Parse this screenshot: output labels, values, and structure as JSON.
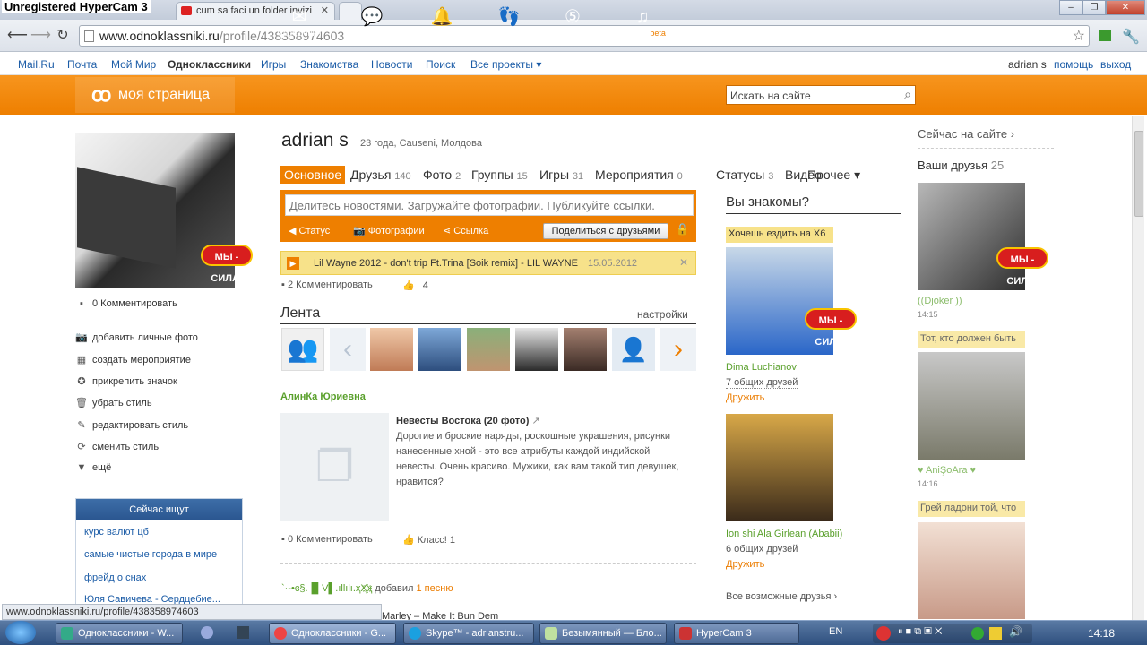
{
  "recorder_watermark": "Unregistered HyperCam 3",
  "browser": {
    "tabs": [
      {
        "title": "cum sa faci un folder invizi"
      }
    ],
    "url_host": "www.odnoklassniki.ru",
    "url_path": "/profile/438358974603"
  },
  "site_nav": {
    "left": [
      "Mail.Ru",
      "Почта",
      "Мой Мир",
      "Одноклассники",
      "Игры",
      "Знакомства",
      "Новости",
      "Поиск",
      "Все проекты ▾"
    ],
    "user": "adrian s",
    "help": "помощь",
    "logout": "выход"
  },
  "orange_bar": {
    "my_page": "моя страница",
    "items": [
      "Сообщения",
      "Обсуждения",
      "Оповещения",
      "Гости",
      "Оценки",
      "Музыка"
    ],
    "music_badge": "beta",
    "search_placeholder": "Искать на сайте"
  },
  "left_sidebar": {
    "avatar_badge": "МЫ - СИЛА!",
    "comment_count": "0 Комментировать",
    "actions": [
      "добавить личные фото",
      "создать мероприятие",
      "прикрепить значок",
      "убрать стиль",
      "редактировать стиль",
      "сменить стиль",
      "ещё"
    ],
    "now_searching_title": "Сейчас ищут",
    "now_searching": [
      "курс валют цб",
      "самые чистые города в мире",
      "фрейд о снах",
      "Юля Савичева - Сердцебие..."
    ]
  },
  "profile": {
    "name": "adrian s",
    "info": "23 года, Causeni, Молдова",
    "tabs": [
      {
        "label": "Основное",
        "count": ""
      },
      {
        "label": "Друзья",
        "count": "140"
      },
      {
        "label": "Фото",
        "count": "2"
      },
      {
        "label": "Группы",
        "count": "15"
      },
      {
        "label": "Игры",
        "count": "31"
      },
      {
        "label": "Мероприятия",
        "count": "0"
      },
      {
        "label": "Статусы",
        "count": "3"
      },
      {
        "label": "Видео",
        "count": ""
      },
      {
        "label": "Прочее ▾",
        "count": ""
      }
    ],
    "share_placeholder": "Делитесь новостями. Загружайте фотографии. Публикуйте ссылки.",
    "share_actions": [
      "Статус",
      "Фотографии",
      "Ссылка"
    ],
    "share_button": "Поделиться с друзьями",
    "now_playing": "Lil Wayne 2012 - don't trip Ft.Trina [Soik remix] - LIL WAYNE",
    "now_playing_date": "15.05.2012",
    "status_comment": "2 Комментировать",
    "status_likes": "4"
  },
  "feed": {
    "title": "Лента",
    "settings": "настройки",
    "author": "АлинКа Юриевна",
    "post_title": "Невесты Востока (20 фото)",
    "post_text": "Дорогие и броские наряды, роскошные украшения, рисунки нанесенные хной - это все атрибуты каждой индийской невесты. Очень красиво. Мужики, как вам такой тип девушек, нравится?",
    "post_comments": "0 Комментировать",
    "post_likes": "Класс! 1",
    "next_author": "`·-•ɞ§.▐▌V▌.ıllılı.ҳҲ҈ҳ",
    "next_action": "добавил",
    "next_link": "1 песню",
    "next_song": "Marley – Make It Bun Dem"
  },
  "suggest": {
    "title": "Вы знакомы?",
    "banner": "Хочешь ездить на Х6",
    "badge": "МЫ - СИЛА!",
    "people": [
      {
        "name": "Dima Luchianov",
        "mutual": "7 общих друзей",
        "action": "Дружить"
      },
      {
        "name": "Ion shi Ala Girlean (Ababii)",
        "mutual": "6 общих друзей",
        "action": "Дружить"
      }
    ],
    "all": "Все возможные друзья ›"
  },
  "right_col": {
    "online": "Сейчас на сайте ›",
    "friends_label": "Ваши друзья",
    "friends_count": "25",
    "badge": "МЫ - СИЛА!",
    "friends": [
      {
        "name": "((Djoker ))",
        "time": "14:15",
        "status": ""
      },
      {
        "name": "♥ AniŞoAra ♥",
        "time": "14:16",
        "status": "Тот, кто должен быть"
      },
      {
        "name": "",
        "time": "",
        "status": "Грей ладони той, что"
      }
    ]
  },
  "status_bar_url": "www.odnoklassniki.ru/profile/438358974603",
  "taskbar": {
    "windows": [
      "Одноклассники - W...",
      "Одноклассники - G...",
      "Skype™ - adrianstru...",
      "Безымянный — Бло...",
      "HyperCam 3"
    ],
    "lang": "EN",
    "clock": "14:18"
  }
}
